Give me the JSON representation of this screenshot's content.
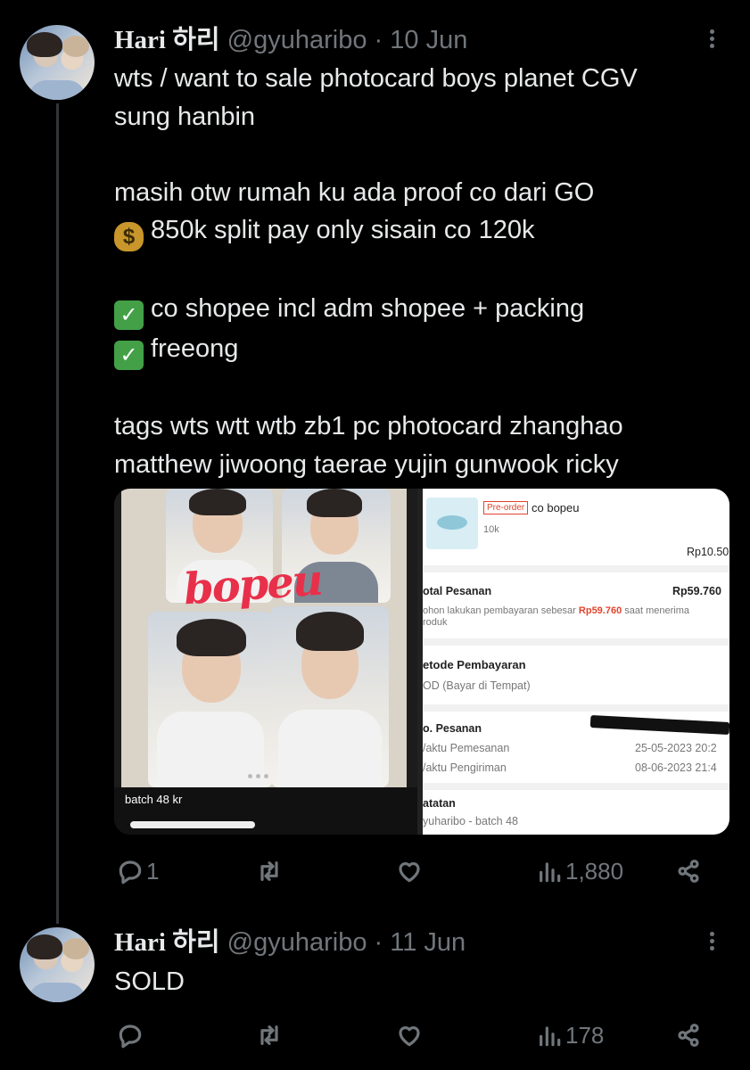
{
  "tweet1": {
    "display_name": "Hari 하리",
    "handle": "@gyuharibo",
    "date": "· 10 Jun",
    "lines": [
      "wts / want to sale photocard boys planet CGV",
      "sung hanbin",
      "",
      "masih otw rumah ku ada proof co dari GO",
      " 850k split pay only sisain co 120k",
      "",
      " co shopee incl adm shopee + packing",
      " freeong",
      "",
      "tags wts wtt wtb zb1 pc photocard zhanghao",
      "matthew jiwoong taerae yujin gunwook ricky"
    ],
    "icons": {
      "money_bag": "money-bag-emoji",
      "check": "check-mark-button-emoji"
    },
    "media": {
      "photo": {
        "handwriting": "bopeu",
        "caption": "batch 48 kr"
      },
      "receipt": {
        "badge": "Pre-order",
        "product_name": "co bopeu",
        "variant": "10k",
        "price": "Rp10.50",
        "total_label": "otal Pesanan",
        "total_value": "Rp59.760",
        "note_prefix": "ohon lakukan pembayaran sebesar",
        "note_amount": "Rp59.760",
        "note_suffix": "saat menerima",
        "note_line2": "roduk",
        "payment_label": "etode Pembayaran",
        "payment_value": "OD (Bayar di Tempat)",
        "order_no_label": "o. Pesanan",
        "order_time_label": "/aktu Pemesanan",
        "order_time_value": "25-05-2023 20:2",
        "ship_time_label": "/aktu Pengiriman",
        "ship_time_value": "08-06-2023 21:4",
        "notes_label": "atatan",
        "notes_value": "yuharibo - batch 48"
      }
    },
    "stats": {
      "replies": "1",
      "retweets": "",
      "likes": "",
      "views": "1,880"
    }
  },
  "tweet2": {
    "display_name": "Hari 하리",
    "handle": "@gyuharibo",
    "date": "· 11 Jun",
    "text": "SOLD",
    "stats": {
      "replies": "",
      "retweets": "",
      "likes": "",
      "views": "178"
    }
  },
  "colors": {
    "background": "#000000",
    "text": "#e7e9ea",
    "muted": "#71767b",
    "accent_orange": "#e0442c"
  }
}
